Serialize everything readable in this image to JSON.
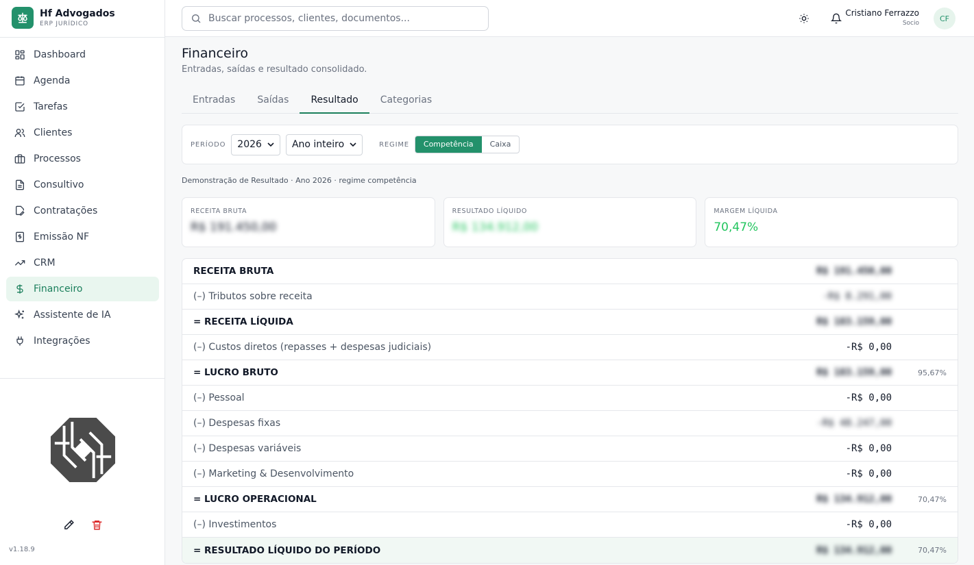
{
  "brand": {
    "name": "Hf Advogados",
    "subtitle": "ERP JURÍDICO"
  },
  "nav": [
    {
      "label": "Dashboard",
      "icon": "dashboard-icon"
    },
    {
      "label": "Agenda",
      "icon": "calendar-icon"
    },
    {
      "label": "Tarefas",
      "icon": "checkbox-icon"
    },
    {
      "label": "Clientes",
      "icon": "users-icon"
    },
    {
      "label": "Processos",
      "icon": "briefcase-icon"
    },
    {
      "label": "Consultivo",
      "icon": "document-icon"
    },
    {
      "label": "Contratações",
      "icon": "edit-document-icon"
    },
    {
      "label": "Emissão NF",
      "icon": "receipt-icon"
    },
    {
      "label": "CRM",
      "icon": "trend-icon"
    },
    {
      "label": "Financeiro",
      "icon": "dollar-icon",
      "active": true
    },
    {
      "label": "Assistente de IA",
      "icon": "sparkles-icon"
    },
    {
      "label": "Integrações",
      "icon": "plug-icon"
    }
  ],
  "version": "v1.18.9",
  "search": {
    "placeholder": "Buscar processos, clientes, documentos..."
  },
  "user": {
    "name": "Cristiano Ferrazzo",
    "role": "Socio",
    "initials": "CF"
  },
  "page": {
    "title": "Financeiro",
    "subtitle": "Entradas, saídas e resultado consolidado."
  },
  "tabs": [
    "Entradas",
    "Saídas",
    "Resultado",
    "Categorias"
  ],
  "active_tab": "Resultado",
  "filters": {
    "period_label": "PERÍODO",
    "year": "2026",
    "range": "Ano inteiro",
    "regime_label": "REGIME",
    "regime_options": [
      "Competência",
      "Caixa"
    ],
    "regime_selected": "Competência"
  },
  "caption": "Demonstração de Resultado · Ano 2026 · regime competência",
  "cards": [
    {
      "label": "RECEITA BRUTA",
      "value": "R$ 191.450,00",
      "blurred": true
    },
    {
      "label": "RESULTADO LÍQUIDO",
      "value": "R$ 134.912,00",
      "blurred": true,
      "color": "#22c55e"
    },
    {
      "label": "MARGEM LÍQUIDA",
      "value": "70,47%",
      "color": "#22c55e"
    }
  ],
  "dre_rows": [
    {
      "label": "RECEITA BRUTA",
      "value": "R$ 191.450,00",
      "bold": true,
      "blurred": true,
      "pct": ""
    },
    {
      "label": "(–) Tributos sobre receita",
      "value": "-R$ 8.291,00",
      "bold": false,
      "blurred": true,
      "pct": ""
    },
    {
      "label": "= RECEITA LÍQUIDA",
      "value": "R$ 183.159,00",
      "bold": true,
      "blurred": true,
      "pct": ""
    },
    {
      "label": "(–) Custos diretos (repasses + despesas judiciais)",
      "value": "-R$ 0,00",
      "bold": false,
      "blurred": false,
      "pct": ""
    },
    {
      "label": "= LUCRO BRUTO",
      "value": "R$ 183.159,00",
      "bold": true,
      "blurred": true,
      "pct": "95,67%"
    },
    {
      "label": "(–) Pessoal",
      "value": "-R$ 0,00",
      "bold": false,
      "blurred": false,
      "pct": ""
    },
    {
      "label": "(–) Despesas fixas",
      "value": "-R$ 48.247,00",
      "bold": false,
      "blurred": true,
      "pct": ""
    },
    {
      "label": "(–) Despesas variáveis",
      "value": "-R$ 0,00",
      "bold": false,
      "blurred": false,
      "pct": ""
    },
    {
      "label": "(–) Marketing & Desenvolvimento",
      "value": "-R$ 0,00",
      "bold": false,
      "blurred": false,
      "pct": ""
    },
    {
      "label": "= LUCRO OPERACIONAL",
      "value": "R$ 134.912,00",
      "bold": true,
      "blurred": true,
      "pct": "70,47%"
    },
    {
      "label": "(–) Investimentos",
      "value": "-R$ 0,00",
      "bold": false,
      "blurred": false,
      "pct": ""
    },
    {
      "label": "= RESULTADO LÍQUIDO DO PERÍODO",
      "value": "R$ 134.912,00",
      "bold": true,
      "blurred": true,
      "pct": "70,47%"
    }
  ]
}
